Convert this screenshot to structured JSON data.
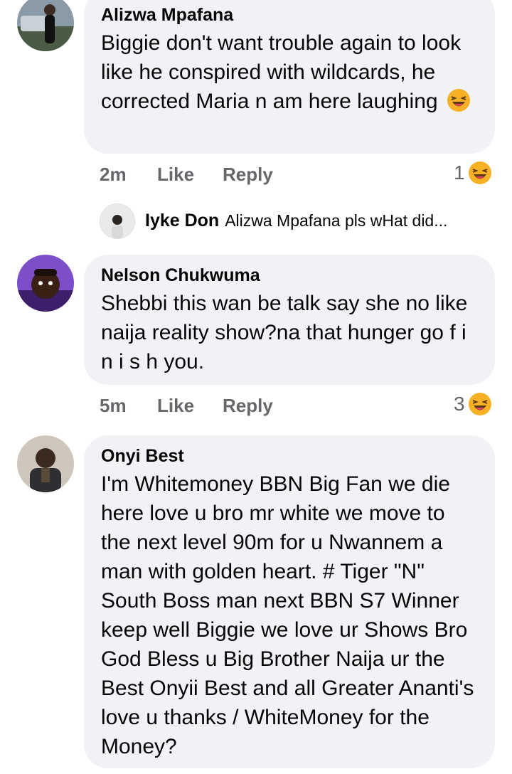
{
  "comments": [
    {
      "author": "Alizwa  Mpafana",
      "text": "Biggie don't want trouble again to look like he conspired with wildcards, he corrected Maria n am here laughing",
      "time": "2m",
      "like": "Like",
      "reply": "Reply",
      "reaction_count": "1",
      "reaction_icon": "laughing-emoji"
    },
    {
      "author": "Nelson Chukwuma",
      "text": "Shebbi this wan be talk say she no like naija reality show?na that hunger go f i n i s h you.",
      "time": "5m",
      "like": "Like",
      "reply": "Reply",
      "reaction_count": "3",
      "reaction_icon": "laughing-emoji"
    },
    {
      "author": "Onyi Best",
      "text": "I'm Whitemoney BBN Big Fan we die here love u bro mr white we move to the next level 90m for u Nwannem a man with golden heart. # Tiger \"N\" South Boss man next BBN S7 Winner keep well Biggie we love ur Shows Bro God Bless u Big Brother Naija ur the Best Onyii Best and all Greater Ananti's love u thanks / WhiteMoney for the Money?"
    }
  ],
  "reply_preview": {
    "author": "Iyke Don",
    "snippet": "Alizwa Mpafana pls wHat did..."
  }
}
